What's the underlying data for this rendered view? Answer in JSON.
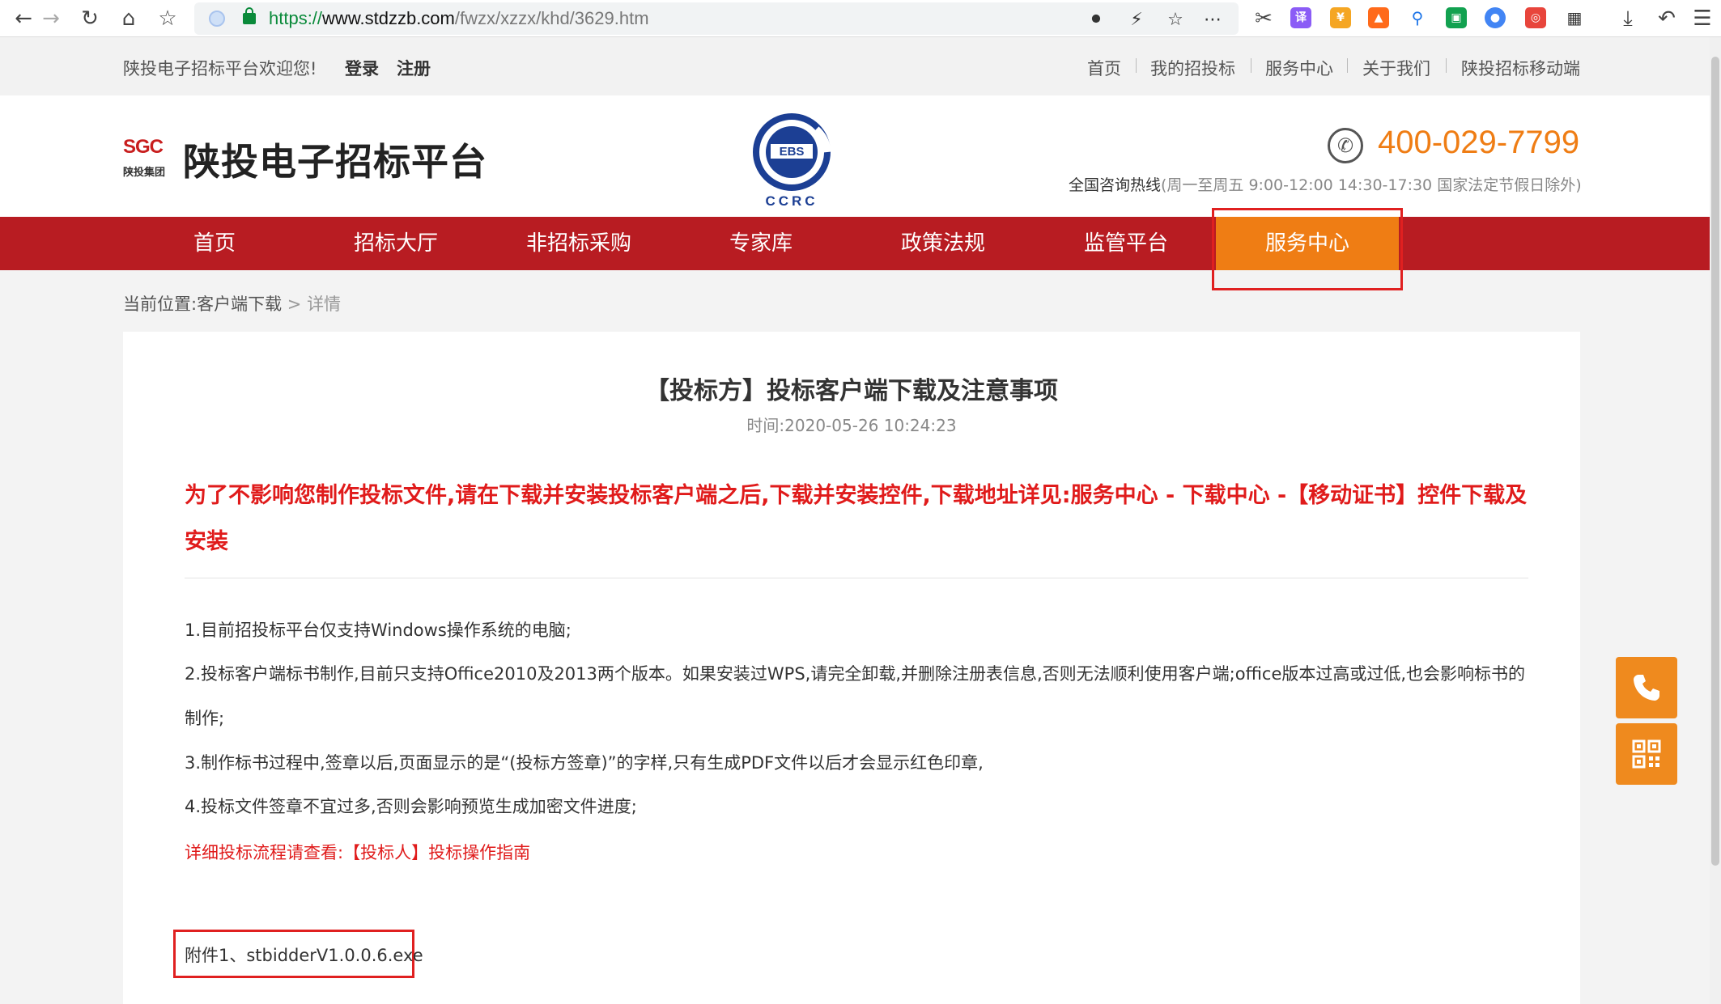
{
  "browser": {
    "url_scheme": "https://",
    "url_host": "www.stdzzb.com",
    "url_path": "/fwzx/xzzx/khd/3629.htm",
    "ext_translate": "译",
    "ext_yellow": "¥"
  },
  "topbar": {
    "welcome": "陕投电子招标平台欢迎您!",
    "login": "登录",
    "register": "注册",
    "links": [
      "首页",
      "我的招投标",
      "服务中心",
      "关于我们",
      "陕投招标移动端"
    ]
  },
  "header": {
    "logo_mark": "SGC",
    "logo_group": "陕投集团",
    "site_title": "陕投电子招标平台",
    "badge_mid": "EBS",
    "badge_bottom": "CCRC",
    "phone": "400-029-7799",
    "hotline_label": "全国咨询热线",
    "hotline_hours": "(周一至周五 9:00-12:00 14:30-17:30 国家法定节假日除外)"
  },
  "nav": {
    "items": [
      "首页",
      "招标大厅",
      "非招标采购",
      "专家库",
      "政策法规",
      "监管平台",
      "服务中心"
    ],
    "active_index": 6
  },
  "breadcrumb": {
    "prefix": "当前位置:",
    "section": "客户端下载",
    "sep": ">",
    "current": "详情"
  },
  "article": {
    "title": "【投标方】投标客户端下载及注意事项",
    "time": "时间:2020-05-26 10:24:23",
    "warning": "为了不影响您制作投标文件,请在下载并安装投标客户端之后,下载并安装控件,下载地址详见:服务中心 - 下载中心 -【移动证书】控件下载及安装",
    "items": [
      "1.目前招投标平台仅支持Windows操作系统的电脑;",
      "2.投标客户端标书制作,目前只支持Office2010及2013两个版本。如果安装过WPS,请完全卸载,并删除注册表信息,否则无法顺利使用客户端;office版本过高或过低,也会影响标书的制作;",
      "3.制作标书过程中,签章以后,页面显示的是“(投标方签章)”的字样,只有生成PDF文件以后才会显示红色印章,",
      "4.投标文件签章不宜过多,否则会影响预览生成加密文件进度;"
    ],
    "guide_link": "详细投标流程请查看:【投标人】投标操作指南",
    "attachment": "附件1、stbidderV1.0.0.6.exe"
  },
  "colors": {
    "brand_red": "#b81c22",
    "accent_orange": "#ef7d14",
    "warn_red": "#e01b1b",
    "highlight_box": "#e02020"
  }
}
